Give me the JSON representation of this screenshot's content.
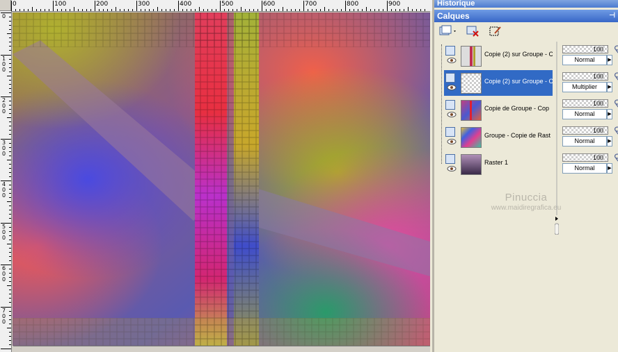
{
  "ruler": {
    "horizontal_labels": [
      "0",
      "100",
      "200",
      "300",
      "400",
      "500",
      "600",
      "700",
      "800",
      "900"
    ],
    "vertical_labels": [
      "0",
      "100",
      "200",
      "300",
      "400",
      "500",
      "600",
      "700"
    ]
  },
  "panel": {
    "history_title": "Historique",
    "layers_title": "Calques"
  },
  "toolbar": {
    "new_layer_icon": "new-layer-icon",
    "delete_layer_icon": "delete-layer-icon",
    "edit_icon": "edit-icon"
  },
  "layers": [
    {
      "name": "Copie (2) sur Groupe - C",
      "opacity": "100",
      "blend": "Normal",
      "selected": false,
      "thumb": "stripe"
    },
    {
      "name": "Copie (2) sur Groupe - C",
      "opacity": "100",
      "blend": "Multiplier",
      "selected": true,
      "thumb": "transparent"
    },
    {
      "name": "Copie de Groupe - Cop",
      "opacity": "100",
      "blend": "Normal",
      "selected": false,
      "thumb": "colorful"
    },
    {
      "name": "Groupe - Copie de Rast",
      "opacity": "100",
      "blend": "Normal",
      "selected": false,
      "thumb": "rainbow"
    },
    {
      "name": "Raster 1",
      "opacity": "100",
      "blend": "Normal",
      "selected": false,
      "thumb": "gradient"
    }
  ],
  "watermark": {
    "line1": "Pinuccia",
    "line2": "www.maidiregrafica.eu"
  },
  "colors": {
    "selection": "#316ac5",
    "titlebar": "#4c7bd0",
    "panel_bg": "#ece9d8"
  }
}
